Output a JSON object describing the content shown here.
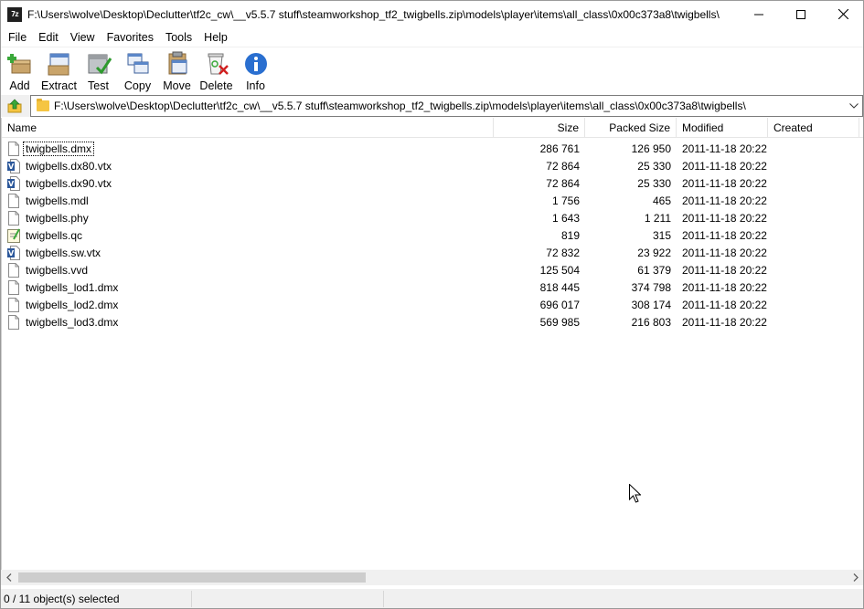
{
  "window": {
    "title": "F:\\Users\\wolve\\Desktop\\Declutter\\tf2c_cw\\__v5.5.7 stuff\\steamworkshop_tf2_twigbells.zip\\models\\player\\items\\all_class\\0x00c373a8\\twigbells\\",
    "app_icon_text": "7z"
  },
  "menu": [
    "File",
    "Edit",
    "View",
    "Favorites",
    "Tools",
    "Help"
  ],
  "toolbar": [
    {
      "label": "Add",
      "icon": "add-icon"
    },
    {
      "label": "Extract",
      "icon": "extract-icon"
    },
    {
      "label": "Test",
      "icon": "test-icon"
    },
    {
      "label": "Copy",
      "icon": "copy-icon"
    },
    {
      "label": "Move",
      "icon": "move-icon"
    },
    {
      "label": "Delete",
      "icon": "delete-icon"
    },
    {
      "label": "Info",
      "icon": "info-icon"
    }
  ],
  "address": {
    "path": "F:\\Users\\wolve\\Desktop\\Declutter\\tf2c_cw\\__v5.5.7 stuff\\steamworkshop_tf2_twigbells.zip\\models\\player\\items\\all_class\\0x00c373a8\\twigbells\\"
  },
  "columns": {
    "name": "Name",
    "size": "Size",
    "packed": "Packed Size",
    "modified": "Modified",
    "created": "Created"
  },
  "files": [
    {
      "name": "twigbells.dmx",
      "size": "286 761",
      "packed": "126 950",
      "modified": "2011-11-18 20:22",
      "icon": "file-icon"
    },
    {
      "name": "twigbells.dx80.vtx",
      "size": "72 864",
      "packed": "25 330",
      "modified": "2011-11-18 20:22",
      "icon": "vtx-icon"
    },
    {
      "name": "twigbells.dx90.vtx",
      "size": "72 864",
      "packed": "25 330",
      "modified": "2011-11-18 20:22",
      "icon": "vtx-icon"
    },
    {
      "name": "twigbells.mdl",
      "size": "1 756",
      "packed": "465",
      "modified": "2011-11-18 20:22",
      "icon": "file-icon"
    },
    {
      "name": "twigbells.phy",
      "size": "1 643",
      "packed": "1 211",
      "modified": "2011-11-18 20:22",
      "icon": "file-icon"
    },
    {
      "name": "twigbells.qc",
      "size": "819",
      "packed": "315",
      "modified": "2011-11-18 20:22",
      "icon": "qc-icon"
    },
    {
      "name": "twigbells.sw.vtx",
      "size": "72 832",
      "packed": "23 922",
      "modified": "2011-11-18 20:22",
      "icon": "vtx-icon"
    },
    {
      "name": "twigbells.vvd",
      "size": "125 504",
      "packed": "61 379",
      "modified": "2011-11-18 20:22",
      "icon": "file-icon"
    },
    {
      "name": "twigbells_lod1.dmx",
      "size": "818 445",
      "packed": "374 798",
      "modified": "2011-11-18 20:22",
      "icon": "file-icon"
    },
    {
      "name": "twigbells_lod2.dmx",
      "size": "696 017",
      "packed": "308 174",
      "modified": "2011-11-18 20:22",
      "icon": "file-icon"
    },
    {
      "name": "twigbells_lod3.dmx",
      "size": "569 985",
      "packed": "216 803",
      "modified": "2011-11-18 20:22",
      "icon": "file-icon"
    }
  ],
  "status": {
    "selection": "0 / 11 object(s) selected"
  }
}
